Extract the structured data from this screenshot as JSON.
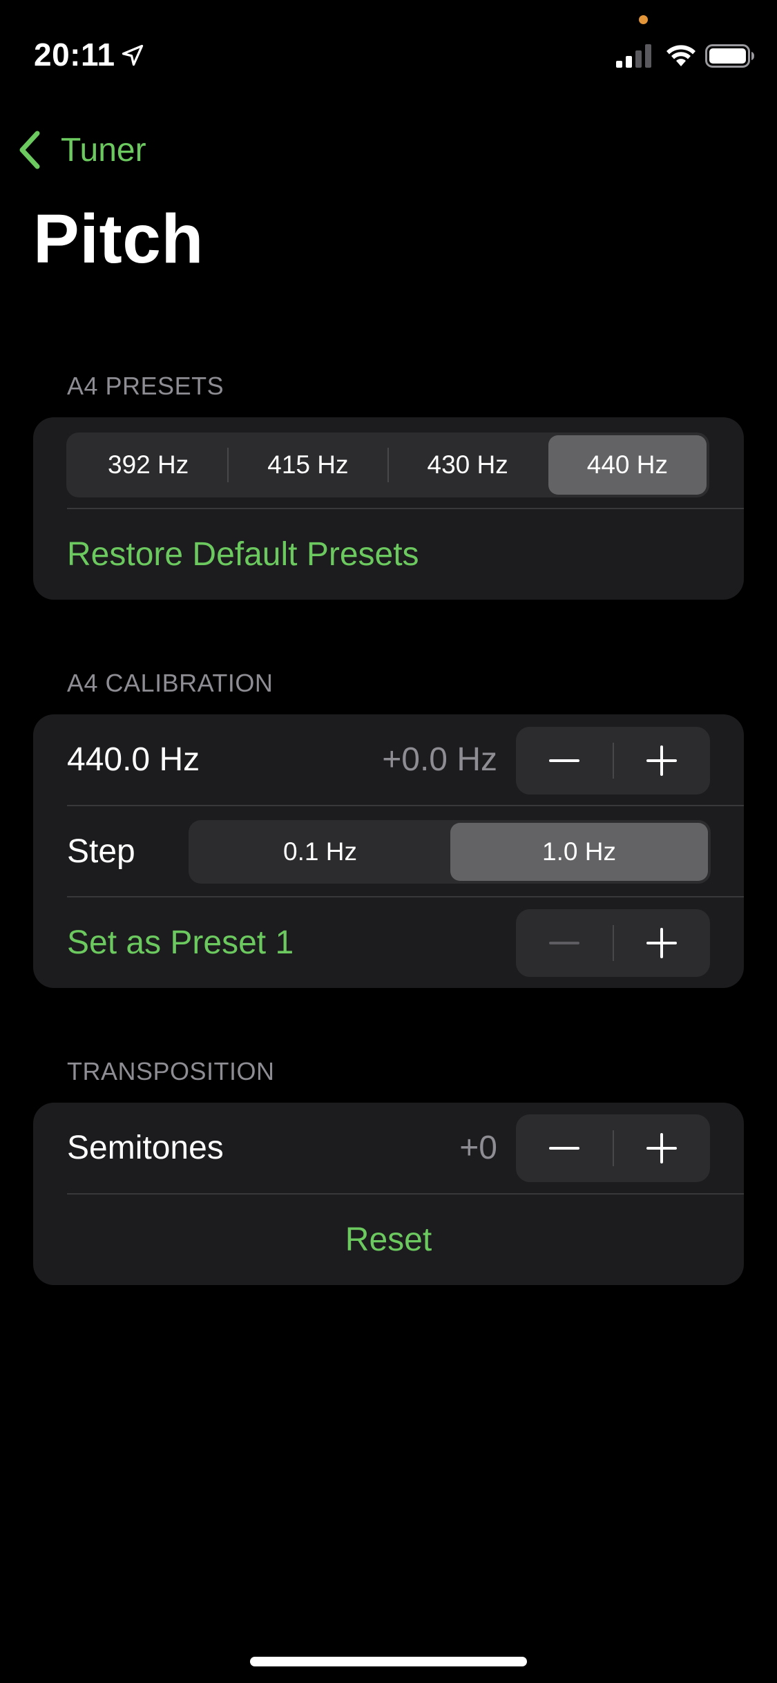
{
  "colors": {
    "background": "#000000",
    "group_background": "#1c1c1e",
    "accent": "#6cc95f",
    "secondary_text": "#8d8d93",
    "privacy_dot": "#e3953a",
    "selected_segment": "#636366"
  },
  "status_bar": {
    "time": "20:11",
    "location_icon": "location-arrow-icon",
    "signal_icon": "cellular-signal-icon",
    "wifi_icon": "wifi-icon",
    "battery_icon": "battery-icon"
  },
  "nav": {
    "back_label": "Tuner",
    "title": "Pitch"
  },
  "a4_presets": {
    "header": "A4 PRESETS",
    "presets": [
      "392 Hz",
      "415 Hz",
      "430 Hz",
      "440 Hz"
    ],
    "selected_preset": "440 Hz",
    "restore_label": "Restore Default Presets"
  },
  "a4_calibration": {
    "header": "A4 CALIBRATION",
    "frequency": "440.0 Hz",
    "offset": "+0.0 Hz",
    "step_label": "Step",
    "step_options": [
      "0.1 Hz",
      "1.0 Hz"
    ],
    "selected_step": "1.0 Hz",
    "set_preset_label": "Set as Preset 1"
  },
  "transposition": {
    "header": "TRANSPOSITION",
    "semitones_label": "Semitones",
    "semitones_value": "+0",
    "reset_label": "Reset"
  }
}
